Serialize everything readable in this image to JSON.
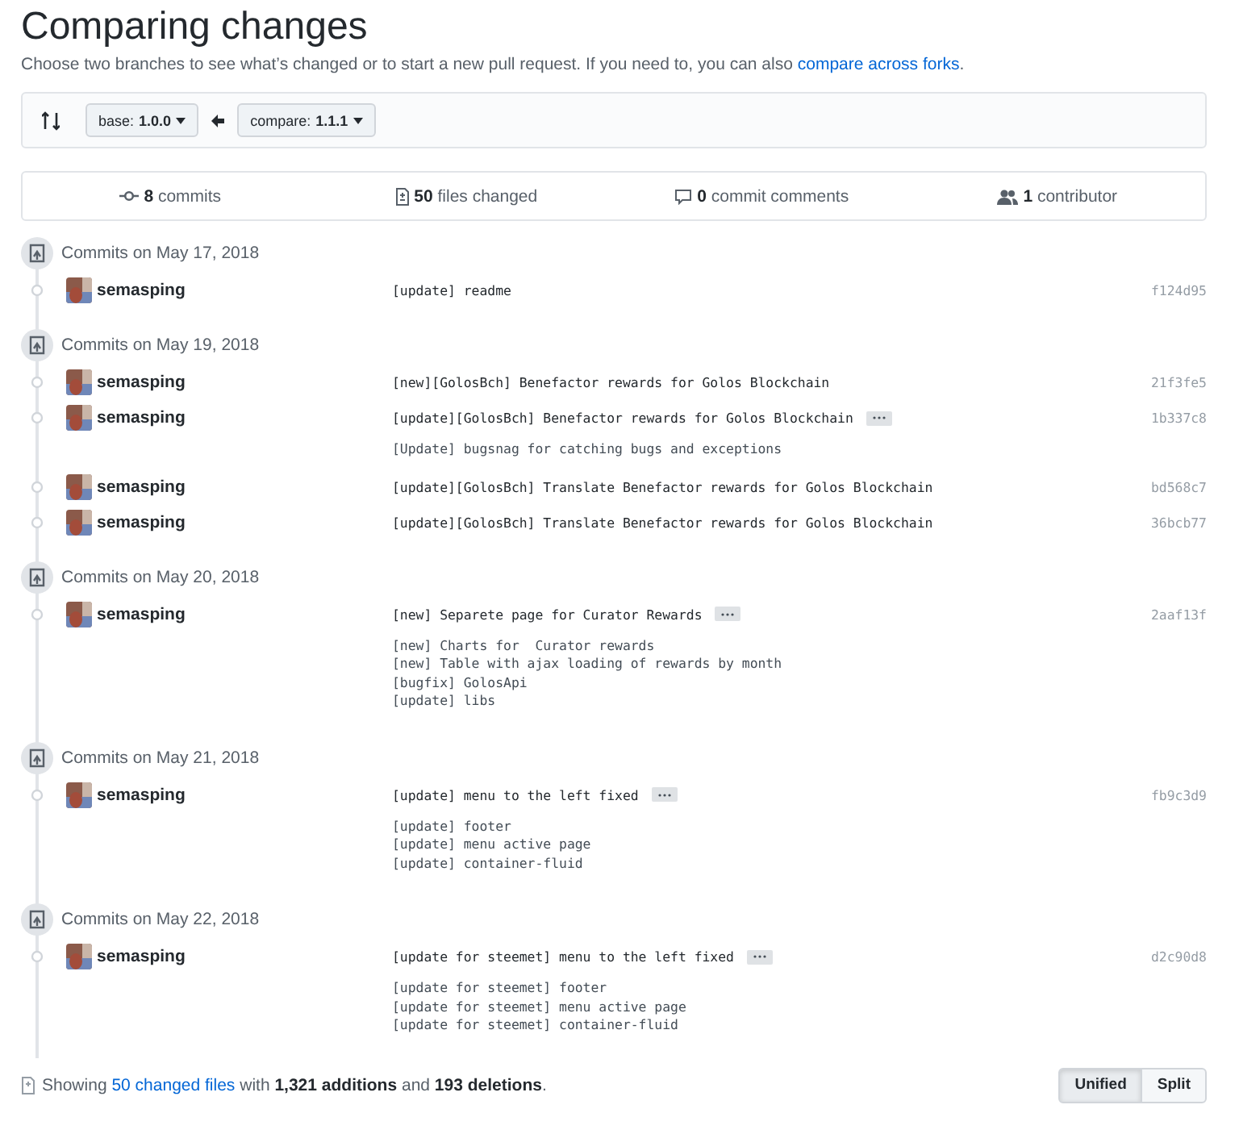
{
  "title": "Comparing changes",
  "subtitle": {
    "text": "Choose two branches to see what’s changed or to start a new pull request. If you need to, you can also",
    "link": "compare across forks",
    "end": "."
  },
  "range": {
    "base": {
      "label": "base:",
      "value": "1.0.0"
    },
    "compare": {
      "label": "compare:",
      "value": "1.1.1"
    }
  },
  "stats": [
    {
      "kind": "commits",
      "text": "**8** commits"
    },
    {
      "kind": "files",
      "text": "**50** files changed"
    },
    {
      "kind": "comments",
      "text": "**0** commit comments"
    },
    {
      "kind": "contributors",
      "text": "**1** contributor"
    }
  ],
  "groups": [
    {
      "date": "Commits on May 17, 2018",
      "commits": [
        {
          "author": "semasping",
          "message": "[update] readme",
          "more": false,
          "sha": "f124d95"
        }
      ]
    },
    {
      "date": "Commits on May 19, 2018",
      "commits": [
        {
          "author": "semasping",
          "message": "[new][GolosBch] Benefactor rewards for Golos Blockchain",
          "more": false,
          "sha": "21f3fe5"
        },
        {
          "author": "semasping",
          "message": "[update][GolosBch] Benefactor rewards for Golos Blockchain",
          "more": true,
          "body": [
            "[Update] bugsnag for catching bugs and exceptions"
          ],
          "sha": "1b337c8"
        },
        {
          "author": "semasping",
          "message": "[update][GolosBch] Translate Benefactor rewards for Golos Blockchain",
          "more": false,
          "sha": "bd568c7"
        },
        {
          "author": "semasping",
          "message": "[update][GolosBch] Translate Benefactor rewards for Golos Blockchain",
          "more": false,
          "sha": "36bcb77"
        }
      ]
    },
    {
      "date": "Commits on May 20, 2018",
      "commits": [
        {
          "author": "semasping",
          "message": "[new] Separete page for Curator Rewards",
          "more": true,
          "body": [
            "[new] Charts for  Curator rewards",
            "[new] Table with ajax loading of rewards by month",
            "[bugfix] GolosApi",
            "[update] libs"
          ],
          "sha": "2aaf13f"
        }
      ]
    },
    {
      "date": "Commits on May 21, 2018",
      "commits": [
        {
          "author": "semasping",
          "message": "[update] menu to the left fixed",
          "more": true,
          "body": [
            "[update] footer",
            "[update] menu active page",
            "[update] container-fluid"
          ],
          "sha": "fb9c3d9"
        }
      ]
    },
    {
      "date": "Commits on May 22, 2018",
      "commits": [
        {
          "author": "semasping",
          "message": "[update for steemet] menu to the left fixed",
          "more": true,
          "body": [
            "[update for steemet] footer",
            "[update for steemet] menu active page",
            "[update for steemet] container-fluid"
          ],
          "sha": "d2c90d8"
        }
      ]
    }
  ],
  "summary": {
    "before": "Showing",
    "link": "50 changed files",
    "after": "with **1,321 additions** and **193 deletions**."
  },
  "view_buttons": [
    {
      "label": "Unified",
      "selected": true
    },
    {
      "label": "Split",
      "selected": false
    }
  ]
}
